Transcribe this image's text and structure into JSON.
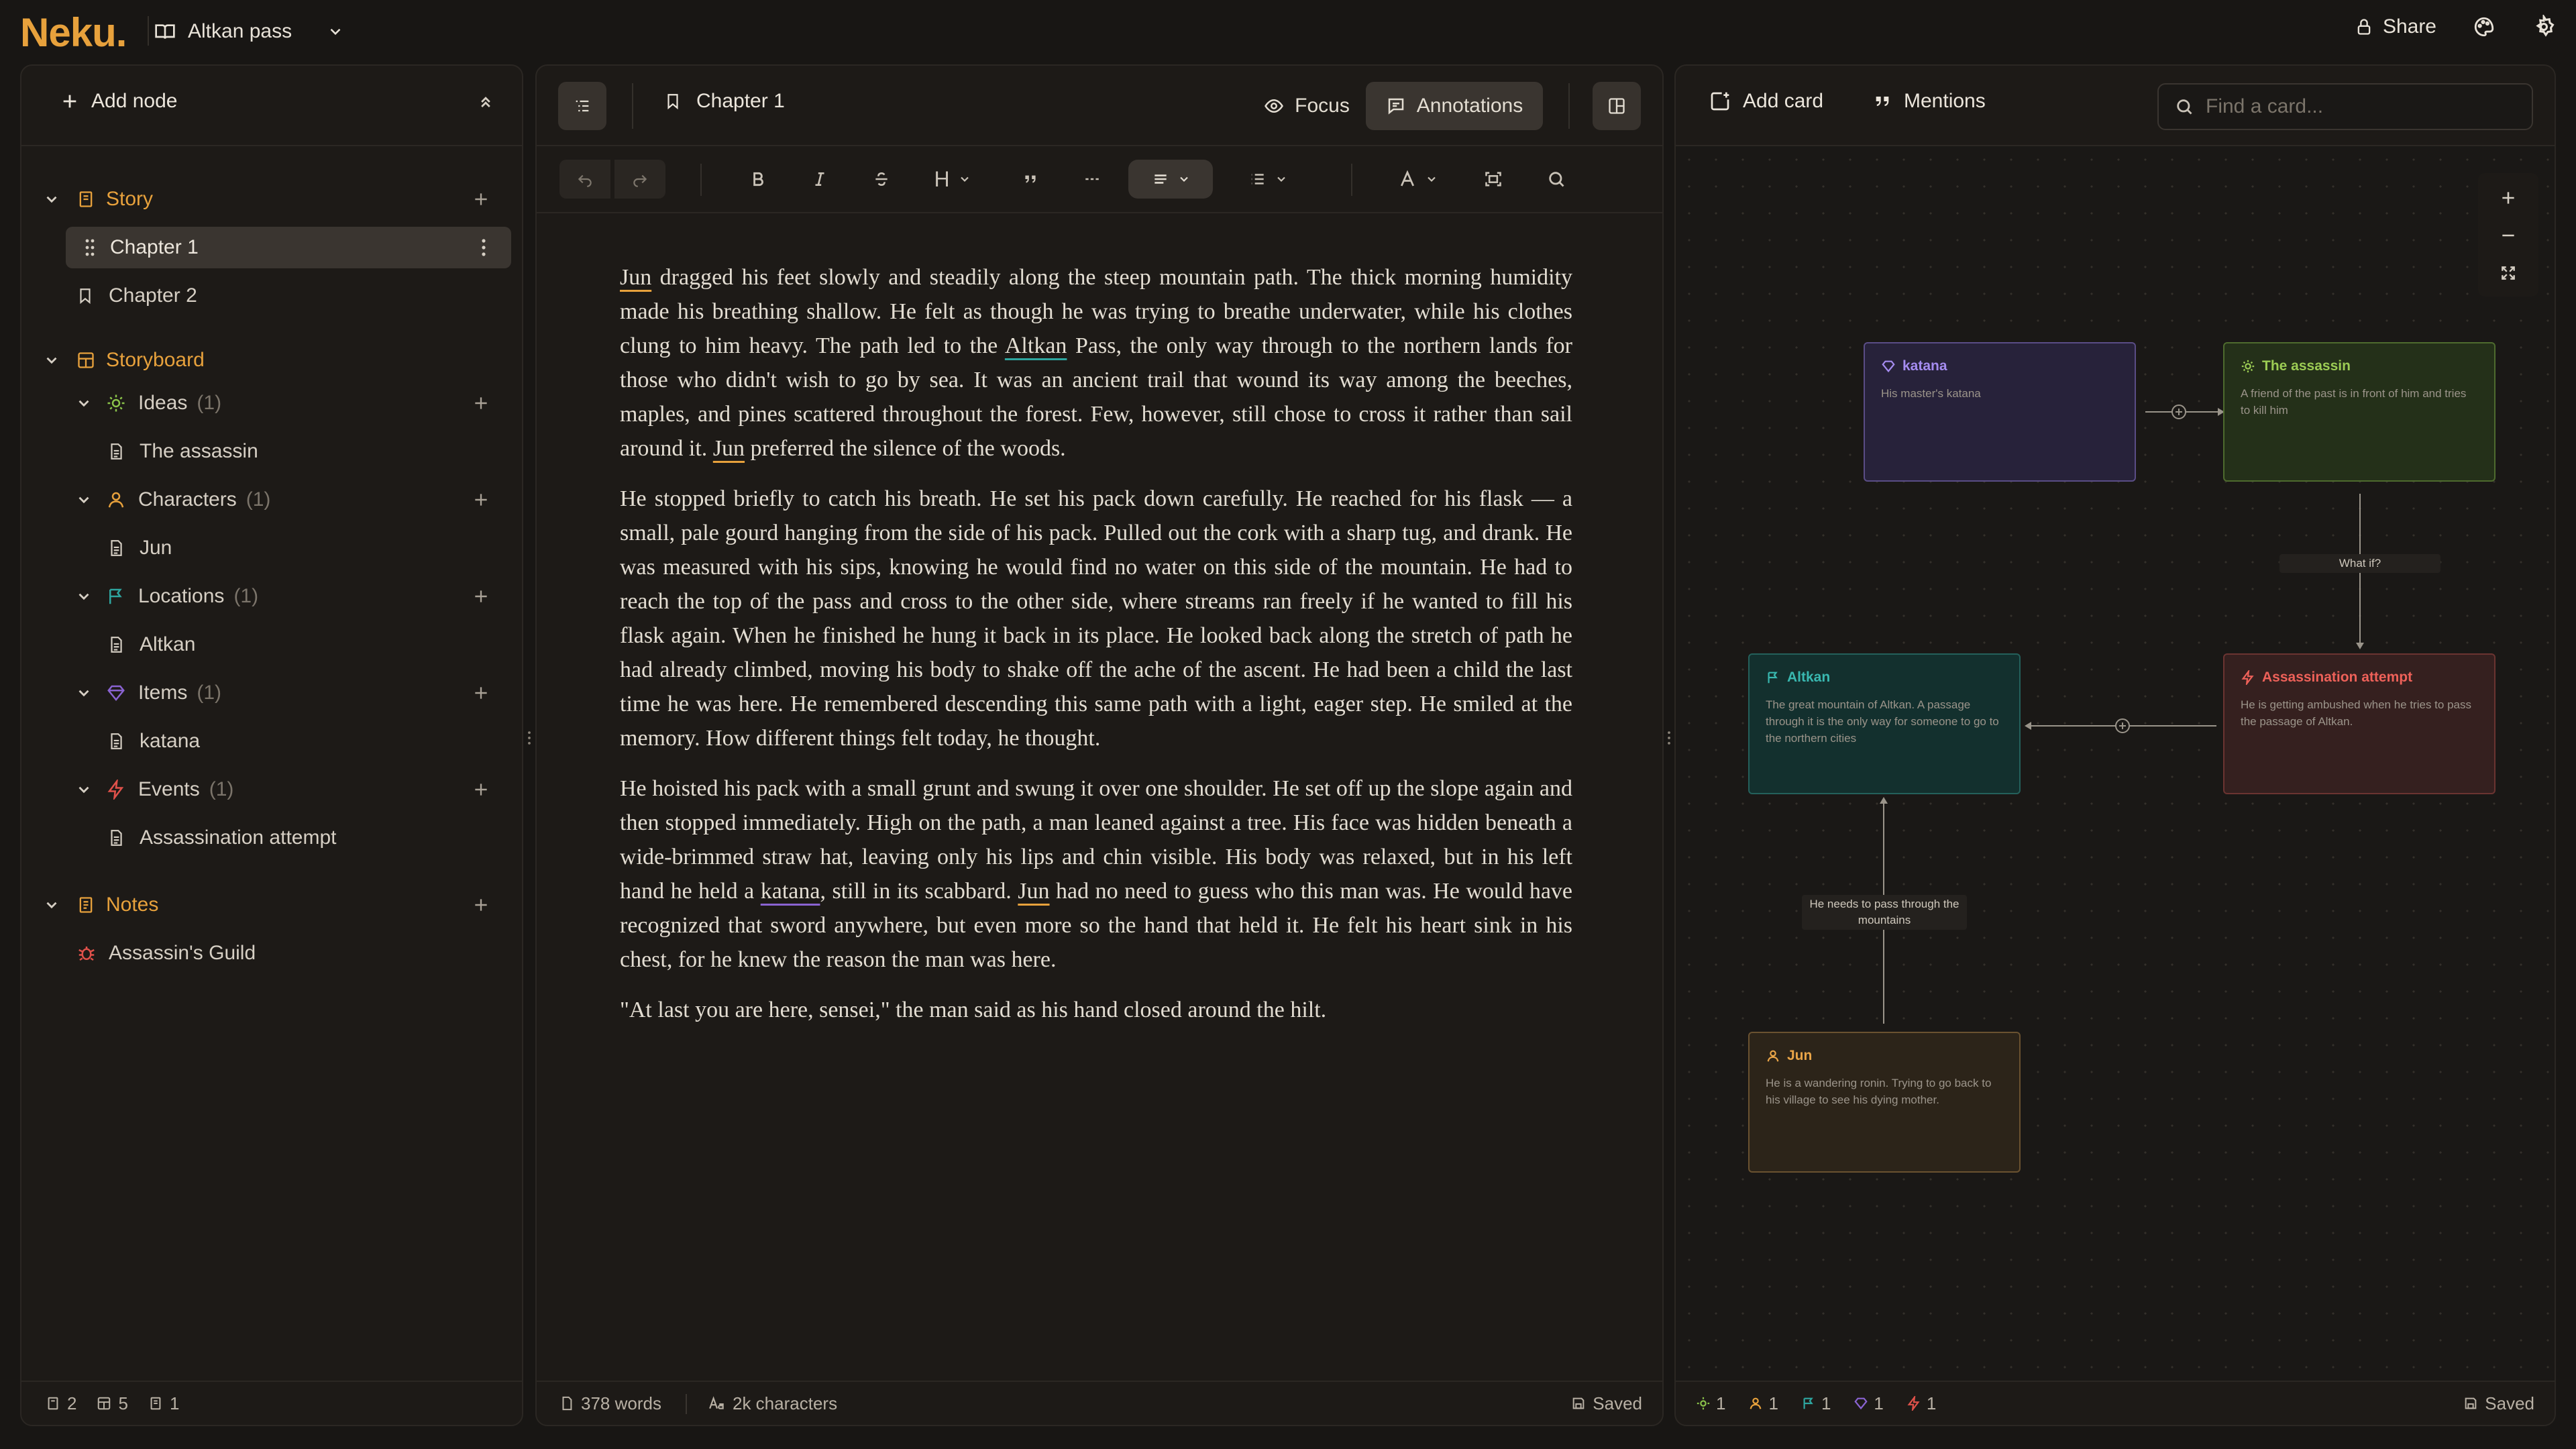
{
  "app": {
    "logo": "Neku.",
    "project_name": "Altkan pass"
  },
  "topbar": {
    "share_label": "Share"
  },
  "sidebar": {
    "add_node_label": "Add node",
    "sections": {
      "story": {
        "label": "Story",
        "items": [
          "Chapter 1",
          "Chapter 2"
        ]
      },
      "storyboard": {
        "label": "Storyboard"
      },
      "ideas": {
        "label": "Ideas",
        "count": "(1)",
        "items": [
          "The assassin"
        ]
      },
      "characters": {
        "label": "Characters",
        "count": "(1)",
        "items": [
          "Jun"
        ]
      },
      "locations": {
        "label": "Locations",
        "count": "(1)",
        "items": [
          "Altkan"
        ]
      },
      "items": {
        "label": "Items",
        "count": "(1)",
        "items": [
          "katana"
        ]
      },
      "events": {
        "label": "Events",
        "count": "(1)",
        "items": [
          "Assassination attempt"
        ]
      },
      "notes": {
        "label": "Notes",
        "items": [
          "Assassin's Guild"
        ]
      }
    },
    "footer": {
      "stories": "2",
      "boards": "5",
      "notes": "1"
    }
  },
  "editor": {
    "chapter_title": "Chapter 1",
    "focus_label": "Focus",
    "annotations_label": "Annotations",
    "heading_glyph": "H",
    "paragraphs": [
      [
        "",
        "Jun",
        " dragged his feet slowly and steadily along the steep mountain path. The thick morning humidity made his breathing shallow. He felt as though he was trying to breathe underwater, while his clothes clung to him heavy. The path led to the ",
        "Altkan",
        " Pass, the only way through to the northern lands for those who didn't wish to go by sea. It was an ancient trail that wound its way among the beeches, maples, and pines scattered throughout the forest. Few, however, still chose to cross it rather than sail around it. ",
        "Jun",
        " preferred the silence of the woods."
      ],
      "He stopped briefly to catch his breath. He set his pack down carefully. He reached for his flask — a small, pale gourd hanging from the side of his pack. Pulled out the cork with a sharp tug, and drank. He was measured with his sips, knowing he would find no water on this side of the mountain. He had to reach the top of the pass and cross to the other side, where streams ran freely if he wanted to fill his flask again. When he finished he hung it back in its place. He looked back along the stretch of path he had already climbed, moving his body to shake off the ache of the ascent. He had been a child the last time he was here. He remembered descending this same path with a light, eager step. He smiled at the memory. How different things felt today, he thought.",
      [
        "He hoisted his pack with a small grunt and swung it over one shoulder. He set off up the slope again and then stopped immediately. High on the path, a man leaned against a tree. His face was hidden beneath a wide-brimmed straw hat, leaving only his lips and chin visible. His body was relaxed, but in his left hand he held a ",
        "katana",
        ", still in its scabbard. ",
        "Jun",
        " had no need to guess who this man was. He would have recognized that sword anywhere, but even more so the hand that held it. He felt his heart sink in his chest, for he knew the reason the man was here."
      ],
      "\"At last you are here, sensei,\" the man said as his hand closed around the hilt."
    ],
    "footer": {
      "words": "378 words",
      "chars": "2k characters",
      "status": "Saved"
    }
  },
  "board": {
    "add_card_label": "Add card",
    "mentions_label": "Mentions",
    "search_placeholder": "Find a card...",
    "cards": {
      "katana": {
        "title": "katana",
        "desc": "His master's katana"
      },
      "assassin": {
        "title": "The assassin",
        "desc": "A friend of the past is in front of him and tries to kill him"
      },
      "altkan": {
        "title": "Altkan",
        "desc": "The great mountain of Altkan. A passage through it is the only way for someone to go to the northern cities"
      },
      "attempt": {
        "title": "Assassination attempt",
        "desc": "He is getting ambushed when he tries to pass the passage of Altkan."
      },
      "jun": {
        "title": "Jun",
        "desc": "He is a wandering ronin. Trying to go back to his village to see his dying mother."
      }
    },
    "edges": {
      "what_if": "What if?",
      "needs_pass": "He needs to pass through the mountains"
    },
    "footer": {
      "ideas": "1",
      "characters": "1",
      "locations": "1",
      "items": "1",
      "events": "1",
      "status": "Saved"
    }
  },
  "colors": {
    "accent": "#e7a13c",
    "idea": "#8bc34a",
    "character": "#e7a13c",
    "location": "#2ea6a0",
    "item": "#8a63d2",
    "event": "#e0514a"
  },
  "icons": [
    "book-icon",
    "chevron-down-icon",
    "lock-icon",
    "palette-icon",
    "gear-icon",
    "plus-icon",
    "collapse-icon",
    "bookmark-icon",
    "board-icon",
    "bulb-icon",
    "person-icon",
    "flag-icon",
    "gem-icon",
    "bolt-icon",
    "doc-icon",
    "bug-icon",
    "eye-icon",
    "comment-icon",
    "undo-icon",
    "redo-icon",
    "bold-icon",
    "italic-icon",
    "strike-icon",
    "quote-icon",
    "divider-icon",
    "align-icon",
    "list-icon",
    "text-color-icon",
    "frame-icon",
    "search-icon",
    "zoom-in-icon",
    "zoom-out-icon",
    "fit-icon",
    "add-card-icon",
    "mentions-icon",
    "save-icon"
  ]
}
